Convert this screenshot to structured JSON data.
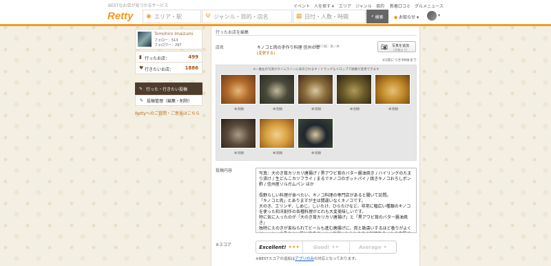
{
  "header": {
    "tagline": "BESTなお店が見つかるサービス",
    "logo": "Retty",
    "nav": [
      "イベント",
      "人を探す ▾",
      "エリア",
      "ジャンル",
      "目的",
      "新着口コミ",
      "グルメニュース"
    ],
    "search": {
      "area_placeholder": "エリア・駅",
      "genre_placeholder": "ジャンル・目的・店名",
      "date_placeholder": "日付・人数・時間",
      "search_label": "検索"
    },
    "notifications_label": "お知らせ ▾"
  },
  "sidebar": {
    "user_name": "Tomohiro Imaizumi",
    "following": "フォロー：513",
    "followers": "フォロワー：297",
    "visited_label": "行ったお店：",
    "visited_count": "499",
    "want_label": "行きたいお店：",
    "want_count": "1886",
    "menu_active": "行った・行きたい投稿",
    "menu_manage": "投稿管理（編集・削除）",
    "feedback": "Rettyへのご質問・ご意見はこちら"
  },
  "main": {
    "page_title": "行ったお店を編集",
    "store_label": "店名",
    "store_name": "キノコと肉の手作り料理 信州の幸",
    "store_near": "最寄り駅：善ノ井",
    "change_link": "[変更する]",
    "add_photo": {
      "label": "写真を追加",
      "sub": "(40枚まで)"
    },
    "photo_note": "※1枚につき3M目まで",
    "panel_hint": "※一番左の写真がタイムラインに表示されます / ドラッグ＆ドロップで順番が変更できます",
    "photos": [
      {
        "caption": "削除",
        "colors": [
          "#b06a2a",
          "#e6b87a",
          "#6a3a1a"
        ]
      },
      {
        "caption": "削除",
        "colors": [
          "#4a4a3a",
          "#c2b89c",
          "#2a2a22"
        ]
      },
      {
        "caption": "削除",
        "colors": [
          "#8a6a3a",
          "#d8c8a0",
          "#3a2a1a"
        ]
      },
      {
        "caption": "削除",
        "colors": [
          "#6a5a2a",
          "#b09a58",
          "#2a2010"
        ]
      },
      {
        "caption": "削除",
        "colors": [
          "#c28a2a",
          "#e8c078",
          "#6a4010"
        ]
      },
      {
        "caption": "削除",
        "colors": [
          "#5a4a3a",
          "#aa9a88",
          "#2a2018"
        ]
      },
      {
        "caption": "削除",
        "colors": [
          "#d8a040",
          "#f0d090",
          "#8a5018"
        ]
      },
      {
        "caption": "削除",
        "colors": [
          "#20262e",
          "#d8c8a0",
          "#3a4a30"
        ]
      }
    ],
    "post_label": "投稿内容",
    "post_text": "写真：大のき茸カリカリ唐揚げ / 黒アワビ茸のバター醤油焼き / ハイリングのたまり漬け / 生どんこカツフライ / まるでキノコのポットパイ / 焼きキノコおろしポン酢 / 信州産ソルガムパン ほか\n\n長野らしい料理が食べたい、キノコ料理の専門店があると聞いて訪問。\n「キノコと肉」とありますが主は間違いなくキノコです。\n大のき、エリンギ、しめじ、しいたけ、ひらたけなど、非常に幅広い種類のキノコを使った和洋創作の各種料理がとれも大変美味しいです。\n特に気に入ったのが「大のき茸カリカリ唐揚げ」と「黒アワビ茸のバター醤油焼き」\n独特にえのきが束ねられてビールも進む唐揚げに、肉と勘違いするほど香りがよくジューシーで柔らかい醤油焼きで、キノコ嫌いな人もここの料理を食べたら克服できるのでは？と思うほどどれも美味しかったです！\nこれだけのバリエーションを揃えていて、どのメニューも外れがないというのは驚きでした。\nきのこマイスターの方がやっているだけあって、しっかり特性を活かして作られているメニューなのでしょう。",
    "score_label": "※スコア",
    "score_options": [
      {
        "label": "Excellent!",
        "stars": "★★★",
        "color": "#222",
        "star_color": "#f09a1e"
      },
      {
        "label": "Good!",
        "stars": "★★",
        "color": "#c8c8c8",
        "star_color": "#c8c8c8"
      },
      {
        "label": "Average",
        "stars": "★",
        "color": "#c8c8c8",
        "star_color": "#c8c8c8"
      }
    ],
    "score_note_prefix": "※BESTスコアの追加は",
    "score_note_link": "アプリのみ",
    "score_note_suffix": "の対応となっております。"
  },
  "colors": {
    "accent": "#f09a1e",
    "sidebar_active": "#4e3c2c",
    "link": "#c06a10"
  }
}
